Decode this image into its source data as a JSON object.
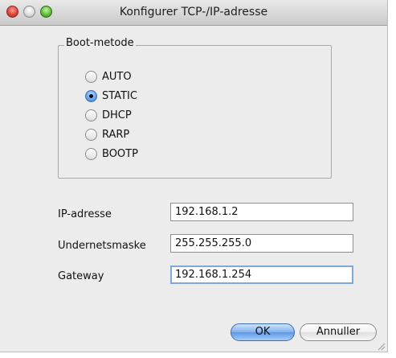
{
  "window": {
    "title": "Konfigurer TCP-/IP-adresse"
  },
  "boot_method": {
    "label": "Boot-metode",
    "options": [
      {
        "label": "AUTO",
        "selected": false
      },
      {
        "label": "STATIC",
        "selected": true
      },
      {
        "label": "DHCP",
        "selected": false
      },
      {
        "label": "RARP",
        "selected": false
      },
      {
        "label": "BOOTP",
        "selected": false
      }
    ]
  },
  "fields": [
    {
      "label": "IP-adresse",
      "value": "192.168.1.2"
    },
    {
      "label": "Undernetsmaske",
      "value": "255.255.255.0"
    },
    {
      "label": "Gateway",
      "value": "192.168.1.254"
    }
  ],
  "buttons": {
    "ok_label": "OK",
    "cancel_label": "Annuller"
  }
}
